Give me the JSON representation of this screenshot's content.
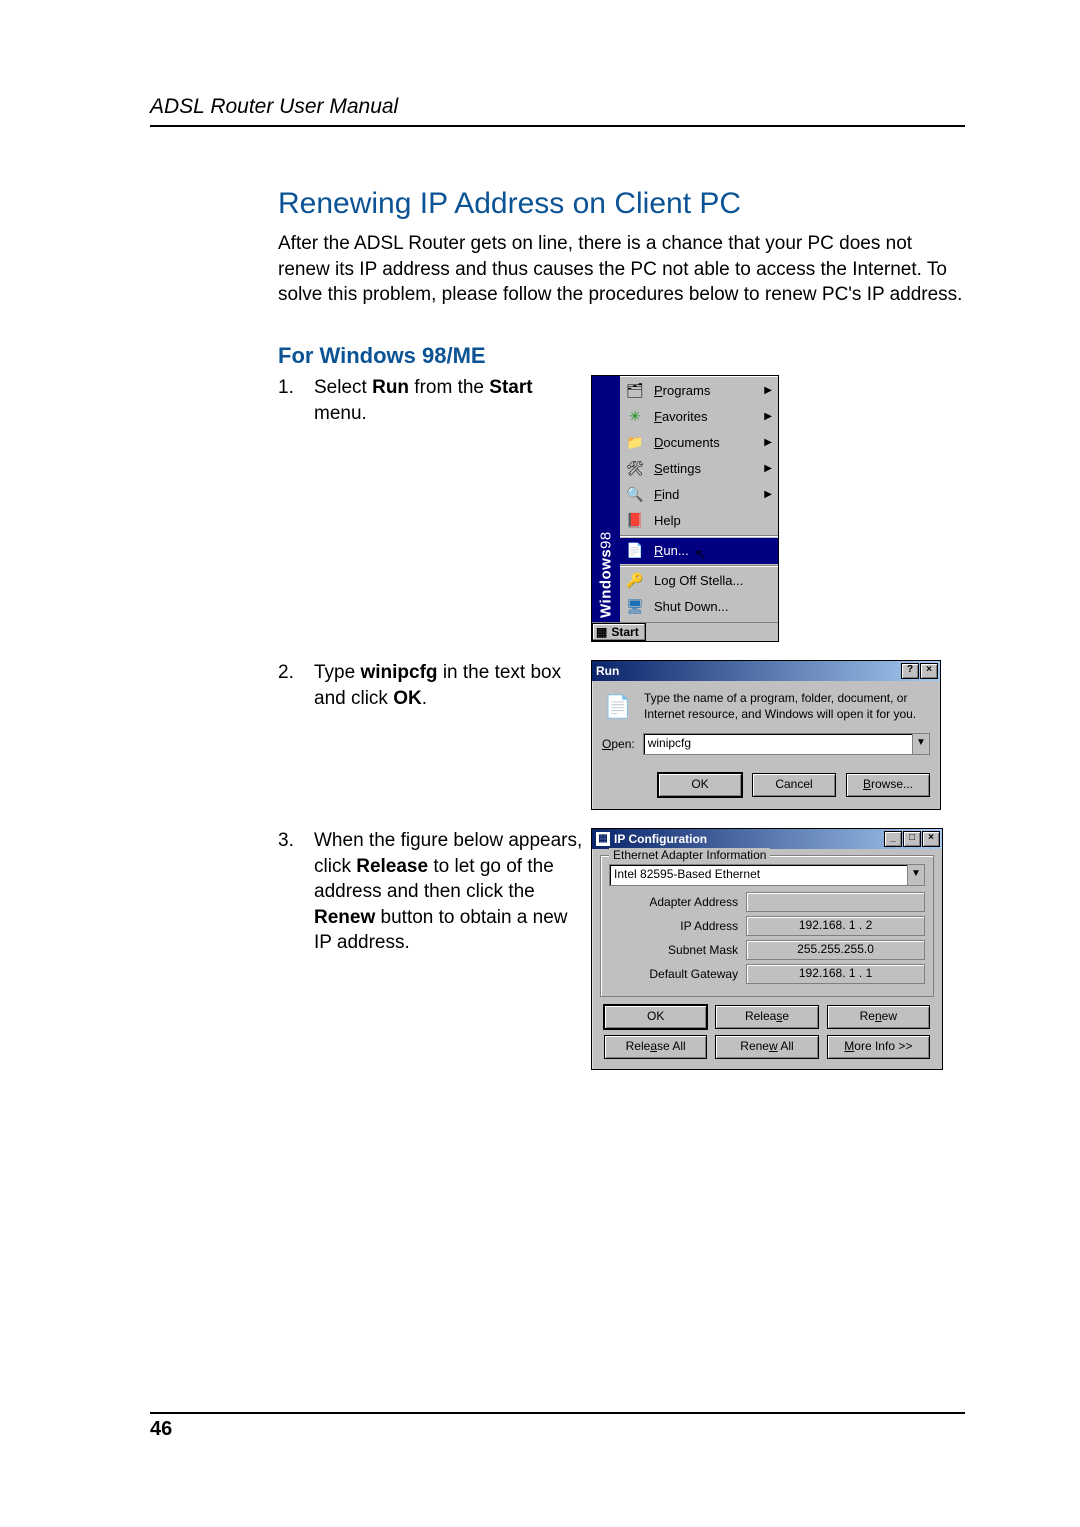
{
  "header": {
    "title": "ADSL Router User Manual"
  },
  "section": {
    "title": "Renewing IP Address on Client PC",
    "intro": "After the ADSL Router gets on line, there is a chance that your PC does not renew its IP address and thus causes the PC not able to access the Internet. To solve this problem, please follow the procedures below to renew PC's IP address."
  },
  "subsection": {
    "title": "For Windows 98/ME"
  },
  "steps": {
    "s1": {
      "num": "1.",
      "pre": "Select ",
      "b1": "Run",
      "mid": " from the ",
      "b2": "Start",
      "post": " menu."
    },
    "s2": {
      "num": "2.",
      "pre": "Type ",
      "b1": "winipcfg",
      "mid": " in the text box and click ",
      "b2": "OK",
      "post": "."
    },
    "s3": {
      "num": "3.",
      "pre": "When the figure below appears, click ",
      "b1": "Release",
      "mid": " to let go of the address and then click the ",
      "b2": "Renew",
      "post": " button to obtain a new IP address."
    }
  },
  "start_menu": {
    "strip_main": "Windows",
    "strip_ver": "98",
    "programs": "Programs",
    "favorites": "Favorites",
    "documents": "Documents",
    "settings": "Settings",
    "find": "Find",
    "help": "Help",
    "run": "Run...",
    "logoff": "Log Off Stella...",
    "shutdown": "Shut Down...",
    "start": "Start"
  },
  "run_dialog": {
    "title": "Run",
    "desc": "Type the name of a program, folder, document, or Internet resource, and Windows will open it for you.",
    "open_label": "Open:",
    "value": "winipcfg",
    "ok": "OK",
    "cancel": "Cancel",
    "browse": "Browse..."
  },
  "ipcfg_dialog": {
    "title": "IP Configuration",
    "group_label": "Ethernet Adapter Information",
    "adapter": "Intel 82595-Based Ethernet",
    "adapter_address_label": "Adapter Address",
    "adapter_address": "",
    "ip_label": "IP Address",
    "ip": "192.168. 1 . 2",
    "mask_label": "Subnet Mask",
    "mask": "255.255.255.0",
    "gw_label": "Default Gateway",
    "gw": "192.168. 1 . 1",
    "ok": "OK",
    "release": "Release",
    "renew": "Renew",
    "release_all": "Release All",
    "renew_all": "Renew All",
    "more_info": "More Info >>"
  },
  "footer": {
    "page_number": "46"
  }
}
